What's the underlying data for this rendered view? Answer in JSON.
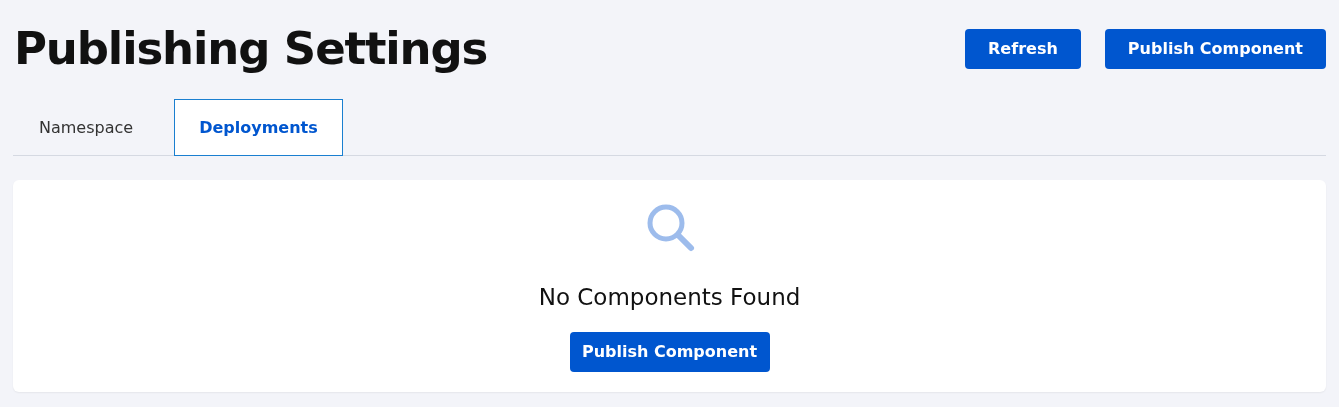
{
  "title": "Publishing Settings",
  "header_buttons": [
    "Refresh",
    "Publish Component"
  ],
  "tabs": [
    {
      "label": "Namespace",
      "selected": false
    },
    {
      "label": "Deployments",
      "selected": true
    }
  ],
  "empty_state": {
    "message": "No Components Found",
    "button": "Publish Component"
  }
}
